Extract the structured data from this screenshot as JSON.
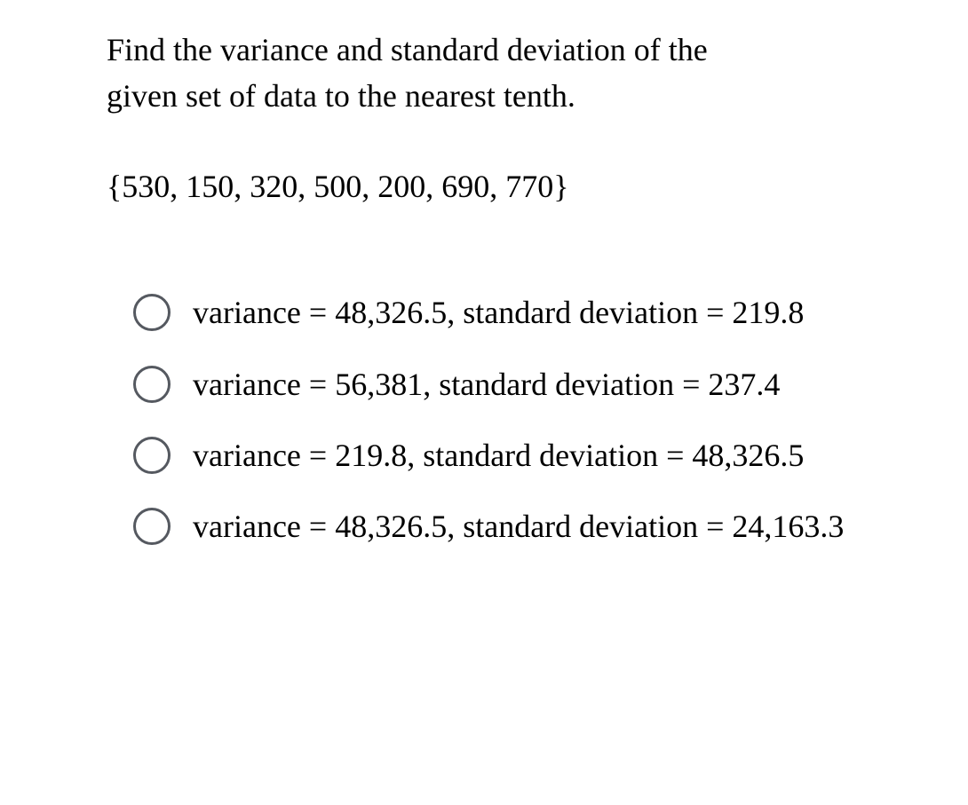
{
  "question": {
    "line1": "Find the variance and standard deviation of the",
    "line2": "given set of data to the nearest tenth."
  },
  "dataset": "{530, 150, 320, 500, 200, 690, 770}",
  "options": [
    {
      "text": "variance = 48,326.5, standard deviation = 219.8"
    },
    {
      "text": "variance = 56,381, standard deviation = 237.4"
    },
    {
      "text": "variance = 219.8, standard deviation = 48,326.5"
    },
    {
      "text": "variance = 48,326.5, standard deviation = 24,163.3"
    }
  ]
}
